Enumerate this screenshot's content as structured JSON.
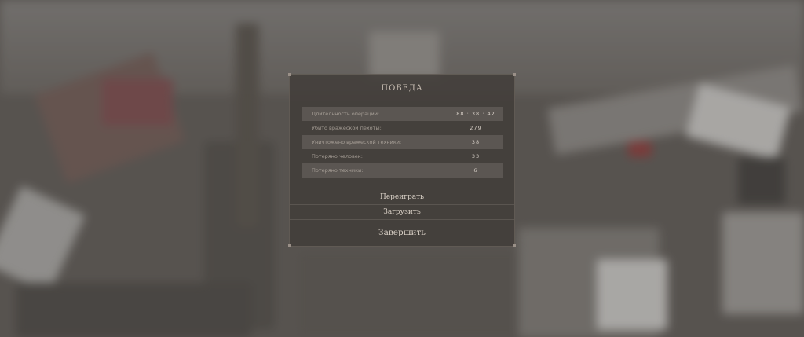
{
  "dialog": {
    "title": "ПОБЕДА",
    "stats": [
      {
        "label": "Длительность операции:",
        "value": "88 : 38 : 42"
      },
      {
        "label": "Убито вражеской пехоты:",
        "value": "279"
      },
      {
        "label": "Уничтожено вражеской техники:",
        "value": "38"
      },
      {
        "label": "Потеряно человек:",
        "value": "33"
      },
      {
        "label": "Потеряно техники:",
        "value": "6"
      }
    ],
    "actions": {
      "replay": "Переиграть",
      "load": "Загрузить",
      "finish": "Завершить"
    }
  }
}
